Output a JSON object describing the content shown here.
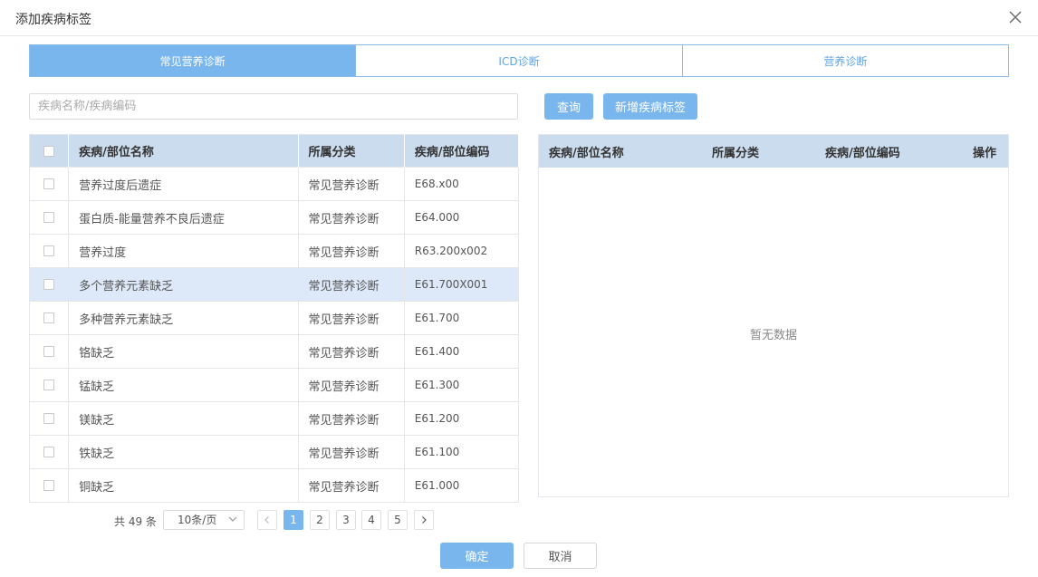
{
  "dialog": {
    "title": "添加疾病标签",
    "close_icon": "close-icon"
  },
  "tabs": [
    {
      "label": "常见营养诊断",
      "active": true
    },
    {
      "label": "ICD诊断",
      "active": false
    },
    {
      "label": "营养诊断",
      "active": false
    }
  ],
  "search": {
    "placeholder": "疾病名称/疾病编码",
    "value": "",
    "query_label": "查询",
    "add_label": "新增疾病标签"
  },
  "left_table": {
    "headers": [
      "疾病/部位名称",
      "所属分类",
      "疾病/部位编码"
    ],
    "rows": [
      {
        "name": "营养过度后遗症",
        "category": "常见营养诊断",
        "code": "E68.x00",
        "highlighted": false
      },
      {
        "name": "蛋白质-能量营养不良后遗症",
        "category": "常见营养诊断",
        "code": "E64.000",
        "highlighted": false
      },
      {
        "name": "营养过度",
        "category": "常见营养诊断",
        "code": "R63.200x002",
        "highlighted": false
      },
      {
        "name": "多个营养元素缺乏",
        "category": "常见营养诊断",
        "code": "E61.700X001",
        "highlighted": true
      },
      {
        "name": "多种营养元素缺乏",
        "category": "常见营养诊断",
        "code": "E61.700",
        "highlighted": false
      },
      {
        "name": "铬缺乏",
        "category": "常见营养诊断",
        "code": "E61.400",
        "highlighted": false
      },
      {
        "name": "锰缺乏",
        "category": "常见营养诊断",
        "code": "E61.300",
        "highlighted": false
      },
      {
        "name": "镁缺乏",
        "category": "常见营养诊断",
        "code": "E61.200",
        "highlighted": false
      },
      {
        "name": "铁缺乏",
        "category": "常见营养诊断",
        "code": "E61.100",
        "highlighted": false
      },
      {
        "name": "铜缺乏",
        "category": "常见营养诊断",
        "code": "E61.000",
        "highlighted": false
      }
    ]
  },
  "right_table": {
    "headers": [
      "疾病/部位名称",
      "所属分类",
      "疾病/部位编码",
      "操作"
    ],
    "empty_text": "暂无数据"
  },
  "pagination": {
    "total_label": "共 49 条",
    "page_size": "10条/页",
    "pages": [
      "1",
      "2",
      "3",
      "4",
      "5"
    ],
    "current_page": "1"
  },
  "footer": {
    "ok_label": "确定",
    "cancel_label": "取消"
  },
  "colors": {
    "accent": "#7ab6ee",
    "header_bg": "#cbdcee",
    "highlight_row": "#dde9f8"
  }
}
